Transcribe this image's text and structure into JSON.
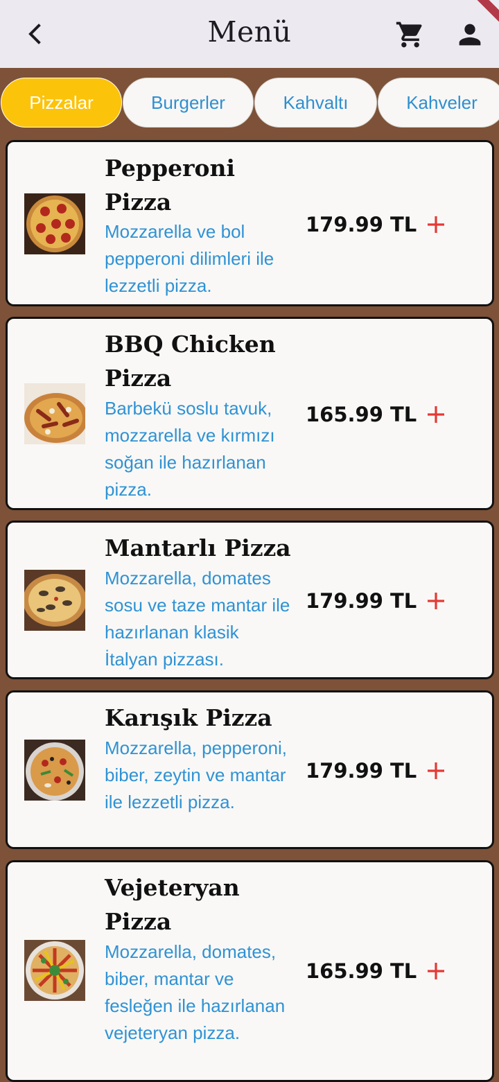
{
  "header": {
    "title": "Menü",
    "back_icon": "back-arrow-icon",
    "cart_icon": "cart-icon",
    "profile_icon": "person-icon"
  },
  "tabs": [
    {
      "label": "Pizzalar",
      "active": true
    },
    {
      "label": "Burgerler",
      "active": false
    },
    {
      "label": "Kahvaltı",
      "active": false
    },
    {
      "label": "Kahveler",
      "active": false
    }
  ],
  "items": [
    {
      "name": "Pepperoni Pizza",
      "description": "Mozzarella ve bol pepperoni dilimleri ile lezzetli pizza.",
      "price": "179.99 TL"
    },
    {
      "name": "BBQ Chicken Pizza",
      "description": "Barbekü soslu tavuk, mozzarella ve kırmızı soğan ile hazırlanan pizza.",
      "price": "165.99 TL"
    },
    {
      "name": "Mantarlı Pizza",
      "description": "Mozzarella, domates sosu ve taze mantar ile hazırlanan klasik İtalyan pizzası.",
      "price": "179.99 TL"
    },
    {
      "name": "Karışık Pizza",
      "description": "Mozzarella, pepperoni, biber, zeytin ve mantar ile lezzetli pizza.",
      "price": "179.99 TL"
    },
    {
      "name": "Vejeteryan Pizza",
      "description": "Mozzarella, domates, biber, mantar ve fesleğen ile hazırlanan vejeteryan pizza.",
      "price": "165.99 TL"
    }
  ],
  "colors": {
    "accent": "#fcc30b",
    "link_blue": "#2f92d4",
    "add_red": "#e53935",
    "background_brown": "#7d5238",
    "appbar": "#eceaf0"
  }
}
